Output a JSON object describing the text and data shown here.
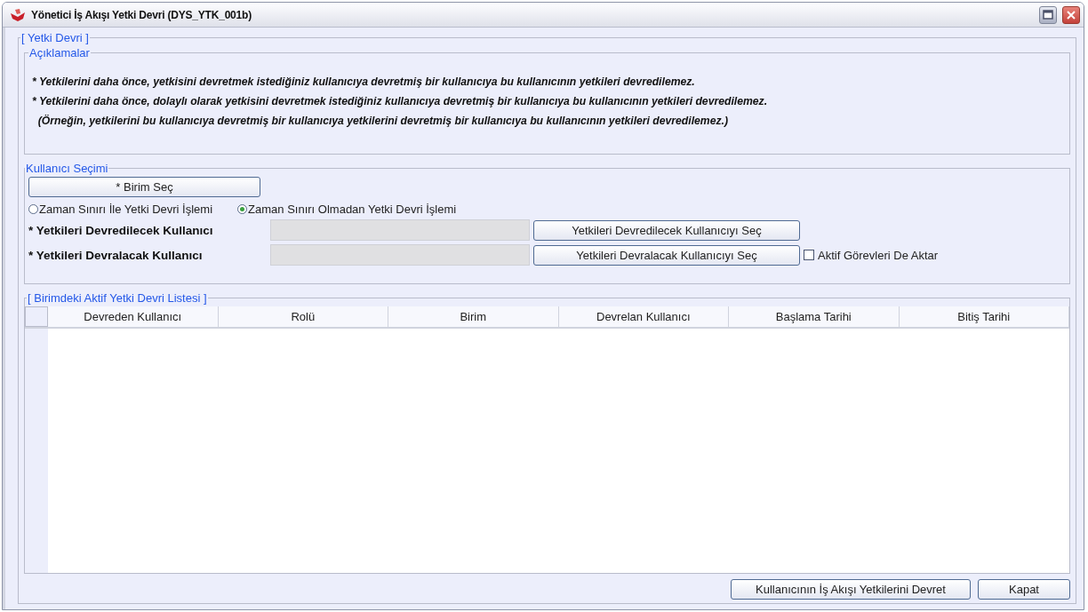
{
  "window": {
    "title": "Yönetici İş Akışı Yetki Devri (DYS_YTK_001b)"
  },
  "main_group": {
    "title": "[ Yetki Devri ]"
  },
  "descriptions": {
    "title": "Açıklamalar",
    "lines": [
      "* Yetkilerini daha önce, yetkisini devretmek istediğiniz kullanıcıya devretmiş bir kullanıcıya bu kullanıcının yetkileri devredilemez.",
      "* Yetkilerini daha önce, dolaylı olarak yetkisini devretmek istediğiniz kullanıcıya devretmiş bir kullanıcıya bu kullanıcının yetkileri devredilemez.",
      "  (Örneğin, yetkilerini bu kullanıcıya devretmiş bir kullanıcıya yetkilerini devretmiş bir kullanıcıya bu kullanıcının yetkileri devredilemez.)"
    ]
  },
  "user_selection": {
    "title": "Kullanıcı Seçimi",
    "unit_button": "* Birim Seç",
    "radios": [
      {
        "label": "Zaman Sınırı İle Yetki Devri İşlemi",
        "selected": false
      },
      {
        "label": "Zaman Sınırı Olmadan Yetki Devri İşlemi",
        "selected": true
      }
    ],
    "fields": [
      {
        "label": "* Yetkileri Devredilecek Kullanıcı",
        "button": "Yetkileri Devredilecek Kullanıcıyı Seç"
      },
      {
        "label": "* Yetkileri Devralacak Kullanıcı",
        "button": "Yetkileri Devralacak Kullanıcıyı Seç"
      }
    ],
    "checkbox": {
      "label": "Aktif Görevleri De Aktar",
      "checked": false
    }
  },
  "list": {
    "title": "[ Birimdeki Aktif Yetki Devri Listesi ]",
    "columns": [
      "Devreden Kullanıcı",
      "Rolü",
      "Birim",
      "Devrelan Kullanıcı",
      "Başlama Tarihi",
      "Bitiş Tarihi"
    ]
  },
  "buttons": [
    "Kullanıcının İş Akışı Yetkilerini Devret",
    "Kapat"
  ]
}
